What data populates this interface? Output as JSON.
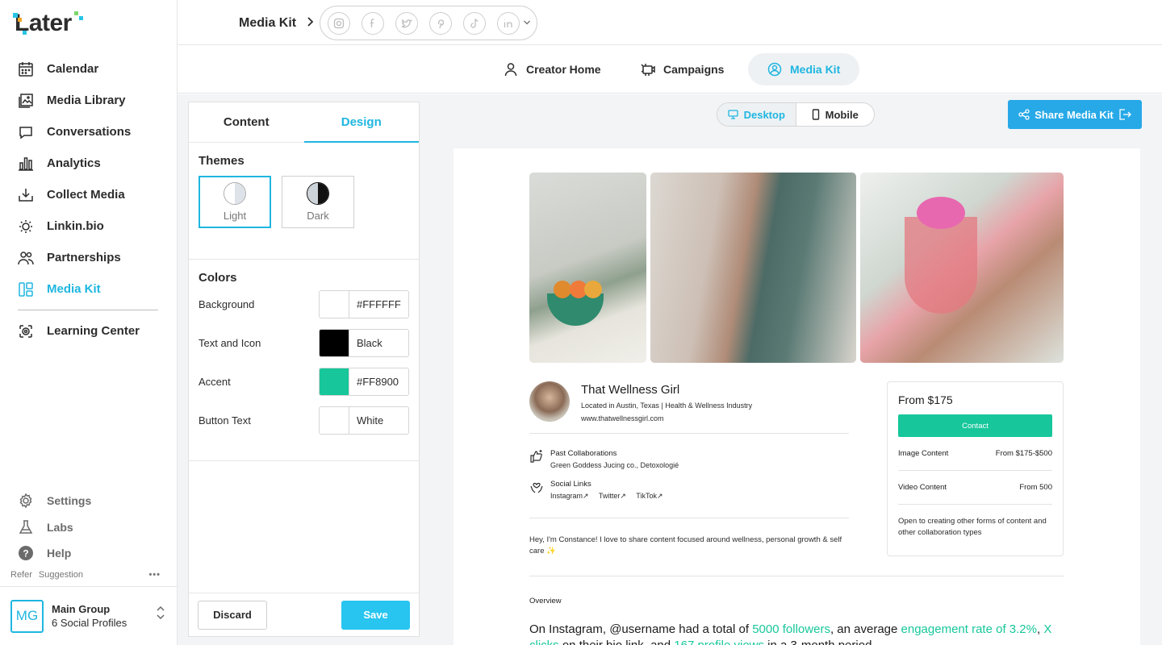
{
  "app": {
    "logo_text": "Later"
  },
  "sidebar": {
    "items": [
      {
        "label": "Calendar",
        "icon": "calendar-icon"
      },
      {
        "label": "Media Library",
        "icon": "image-icon"
      },
      {
        "label": "Conversations",
        "icon": "chat-icon"
      },
      {
        "label": "Analytics",
        "icon": "bar-chart-icon"
      },
      {
        "label": "Collect Media",
        "icon": "download-icon"
      },
      {
        "label": "Linkin.bio",
        "icon": "link-icon"
      },
      {
        "label": "Partnerships",
        "icon": "people-icon"
      },
      {
        "label": "Media Kit",
        "icon": "media-kit-icon",
        "active": true
      },
      {
        "label": "Learning Center",
        "icon": "learning-icon"
      }
    ],
    "bottom_items": [
      {
        "label": "Settings",
        "icon": "gear-icon"
      },
      {
        "label": "Labs",
        "icon": "flask-icon"
      },
      {
        "label": "Help",
        "icon": "help-icon"
      }
    ],
    "refer": "Refer",
    "suggestion": "Suggestion",
    "more": "•••",
    "group": {
      "initials": "MG",
      "name": "Main Group",
      "subtitle": "6 Social Profiles"
    }
  },
  "topbar": {
    "breadcrumb": "Media Kit",
    "social_icons": [
      "instagram-icon",
      "facebook-icon",
      "twitter-icon",
      "pinterest-icon",
      "tiktok-icon",
      "linkedin-icon"
    ]
  },
  "tabs": [
    {
      "label": "Creator Home",
      "icon": "user-icon"
    },
    {
      "label": "Campaigns",
      "icon": "campaign-icon"
    },
    {
      "label": "Media Kit",
      "icon": "media-kit-user-icon",
      "active": true
    }
  ],
  "panel": {
    "tabs": [
      {
        "label": "Content"
      },
      {
        "label": "Design",
        "active": true
      }
    ],
    "themes_title": "Themes",
    "themes": [
      {
        "label": "Light",
        "active": true
      },
      {
        "label": "Dark"
      }
    ],
    "colors_title": "Colors",
    "colors": [
      {
        "label": "Background",
        "value": "#FFFFFF",
        "swatch": "#FFFFFF"
      },
      {
        "label": "Text and Icon",
        "value": "Black",
        "swatch": "#000000"
      },
      {
        "label": "Accent",
        "value": "#FF8900",
        "swatch": "#17C79B"
      },
      {
        "label": "Button Text",
        "value": "White",
        "swatch": "#FFFFFF"
      }
    ],
    "discard_label": "Discard",
    "save_label": "Save"
  },
  "view_toggle": {
    "desktop": "Desktop",
    "mobile": "Mobile",
    "active": "Desktop"
  },
  "share_label": "Share Media Kit",
  "preview": {
    "name": "That Wellness Girl",
    "location": "Located in Austin, Texas | Health & Wellness Industry",
    "website": "www.thatwellnessgirl.com",
    "past_collab_title": "Past Collaborations",
    "past_collab_value": "Green Goddess Jucing co., Detoxologié",
    "social_links_title": "Social Links",
    "social_links": [
      "Instagram↗",
      "Twitter↗",
      "TikTok↗"
    ],
    "bio": "Hey, I'm Constance! I love to share content focused around wellness, personal growth & self care ✨",
    "price_title": "From $175",
    "contact_label": "Contact",
    "price_rows": [
      {
        "label": "Image Content",
        "value": "From $175-$500"
      },
      {
        "label": "Video Content",
        "value": "From 500"
      }
    ],
    "price_note": "Open to creating other forms of content and other collaboration types",
    "overview_label": "Overview",
    "overview": {
      "p1": "On Instagram, @username had a total of ",
      "h1": "5000 followers",
      "p2": ", an average ",
      "h2": "engagement rate of 3.2%",
      "p3": ", ",
      "h3": "X clicks",
      "p4": " on their bio link, and ",
      "h4": "167 profile views",
      "p5": " in a 3-month period."
    }
  },
  "colors": {
    "accent": "#1fb6e0",
    "green": "#17c79b",
    "share": "#27a9e8"
  }
}
